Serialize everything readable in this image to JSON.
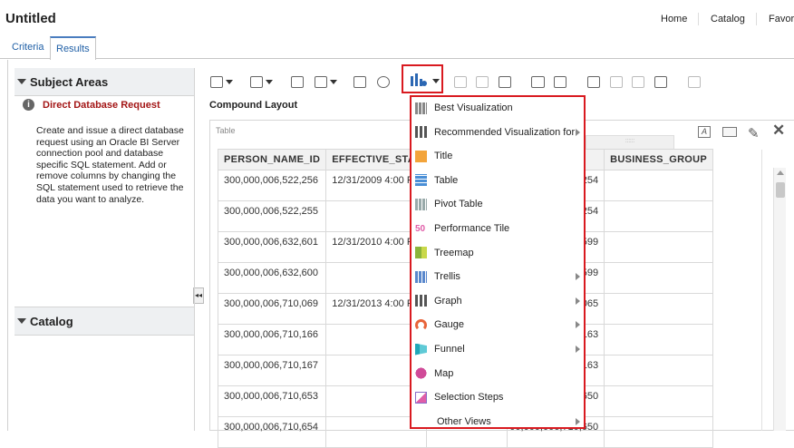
{
  "header": {
    "title": "Untitled",
    "nav": [
      "Home",
      "Catalog",
      "Favor"
    ]
  },
  "tabs": [
    {
      "label": "Criteria",
      "active": false
    },
    {
      "label": "Results",
      "active": true
    }
  ],
  "left_panel": {
    "subject_areas_title": "Subject Areas",
    "direct_request_label": "Direct Database Request",
    "description": "Create and issue a direct database request using an Oracle BI Server connection pool and database specific SQL statement. Add or remove columns by changing the SQL statement used to retrieve the data you want to analyze.",
    "catalog_title": "Catalog"
  },
  "compound_layout": {
    "title": "Compound Layout",
    "view_label": "Table"
  },
  "table": {
    "headers": [
      "PERSON_NAME_ID",
      "EFFECTIVE_STAI",
      "ERSON_ID",
      "BUSINESS_GROUP"
    ],
    "rows": [
      {
        "person_name_id": "300,000,006,522,256",
        "effective": "12/31/2009 4:00 P",
        "person_id": "00,000,006,522,254"
      },
      {
        "person_name_id": "300,000,006,522,255",
        "effective": "",
        "person_id": "00,000,006,522,254"
      },
      {
        "person_name_id": "300,000,006,632,601",
        "effective": "12/31/2010 4:00 P",
        "person_id": "00,000,006,632,599"
      },
      {
        "person_name_id": "300,000,006,632,600",
        "effective": "",
        "person_id": "00,000,006,632,599"
      },
      {
        "person_name_id": "300,000,006,710,069",
        "effective": "12/31/2013 4:00 P",
        "person_id": "00,000,006,710,065"
      },
      {
        "person_name_id": "300,000,006,710,166",
        "effective": "",
        "person_id": "00,000,006,710,163"
      },
      {
        "person_name_id": "300,000,006,710,167",
        "effective": "",
        "person_id": "00,000,006,710,163"
      },
      {
        "person_name_id": "300,000,006,710,653",
        "effective": "",
        "person_id": "00,000,006,710,650"
      },
      {
        "person_name_id": "300,000,006,710,654",
        "effective": "",
        "person_id": "00,000,006,710,650"
      }
    ]
  },
  "menu": {
    "items": [
      {
        "label": "Best Visualization",
        "icon": "grid-icon",
        "submenu": false
      },
      {
        "label": "Recommended Visualization for",
        "icon": "bar-chart-icon",
        "submenu": true
      },
      {
        "label": "Title",
        "icon": "title-icon",
        "submenu": false
      },
      {
        "label": "Table",
        "icon": "table-icon",
        "submenu": false
      },
      {
        "label": "Pivot Table",
        "icon": "pivot-table-icon",
        "submenu": false
      },
      {
        "label": "Performance Tile",
        "icon": "performance-tile-icon",
        "submenu": false
      },
      {
        "label": "Treemap",
        "icon": "treemap-icon",
        "submenu": false
      },
      {
        "label": "Trellis",
        "icon": "trellis-icon",
        "submenu": true
      },
      {
        "label": "Graph",
        "icon": "graph-icon",
        "submenu": true
      },
      {
        "label": "Gauge",
        "icon": "gauge-icon",
        "submenu": true
      },
      {
        "label": "Funnel",
        "icon": "funnel-icon",
        "submenu": true
      },
      {
        "label": "Map",
        "icon": "map-icon",
        "submenu": false
      },
      {
        "label": "Selection Steps",
        "icon": "selection-steps-icon",
        "submenu": false
      },
      {
        "label": "Other Views",
        "icon": "",
        "submenu": true
      }
    ],
    "performance_tile_glyph": "50"
  },
  "colors": {
    "highlight_red": "#d91a20",
    "link_blue": "#1f5fa6",
    "header_red_text": "#a31515"
  }
}
